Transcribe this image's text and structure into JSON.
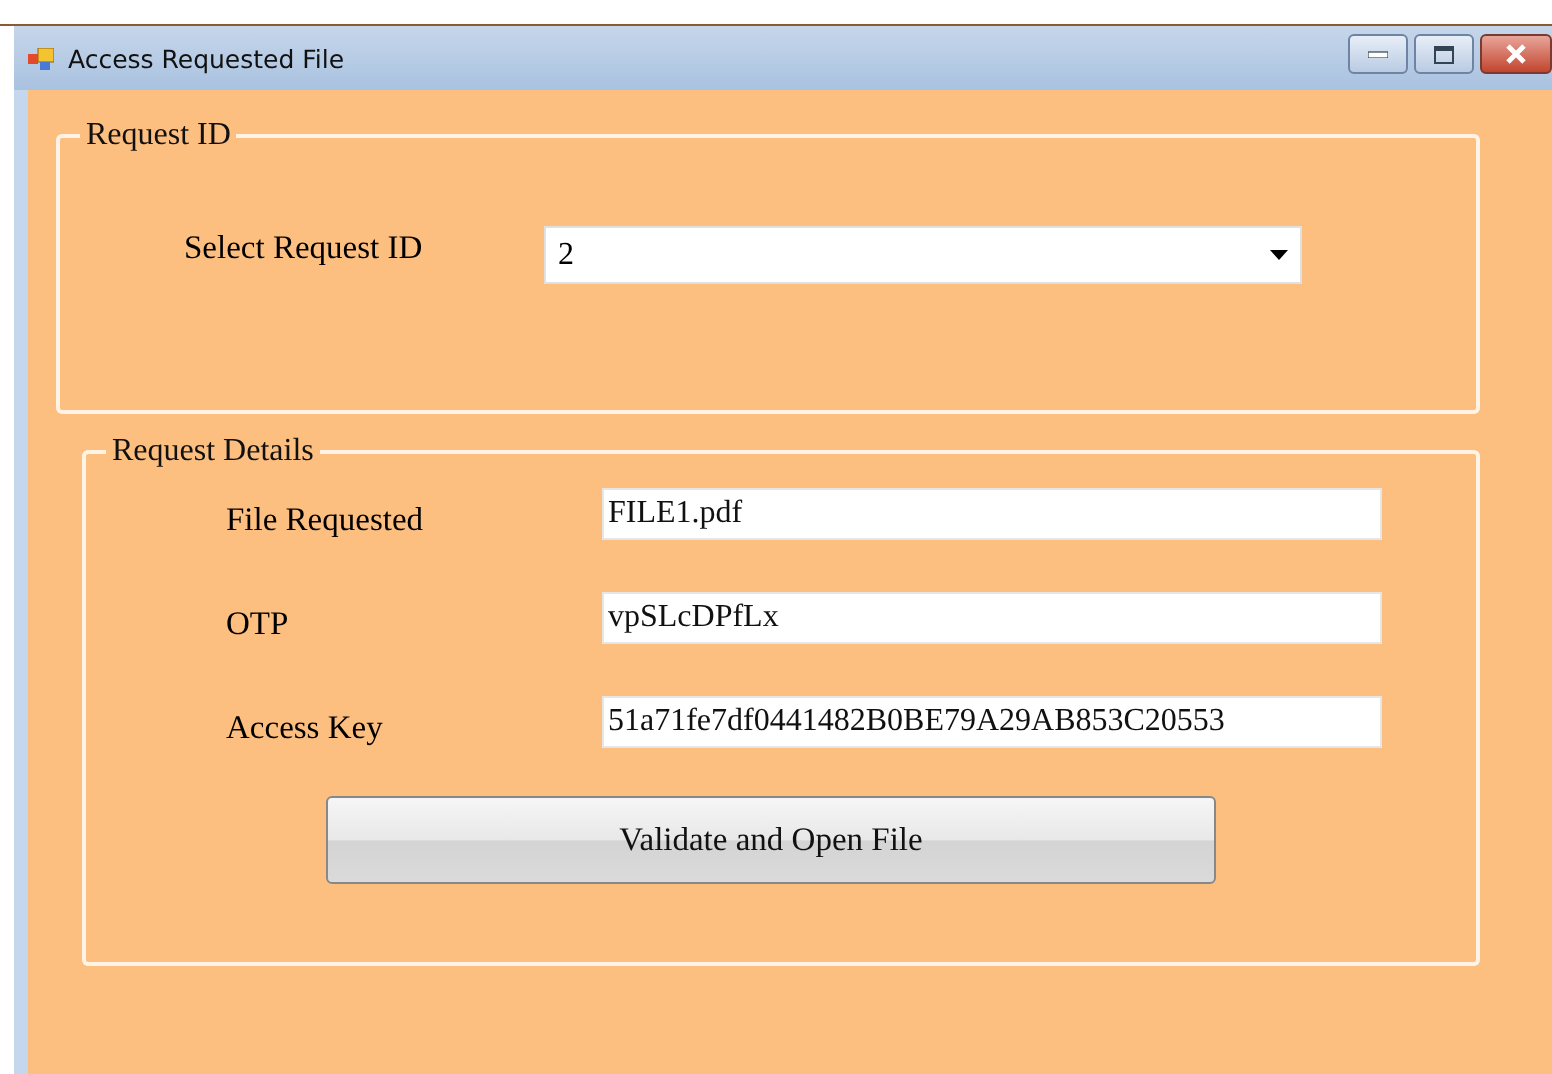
{
  "window": {
    "title": "Access Requested File"
  },
  "request_id_group": {
    "title": "Request ID",
    "label": "Select Request ID",
    "value": "2"
  },
  "details_group": {
    "title": "Request Details",
    "fields": [
      {
        "label": "File Requested",
        "value": "FILE1.pdf"
      },
      {
        "label": "OTP",
        "value": "vpSLcDPfLx"
      },
      {
        "label": "Access Key",
        "value": "51a71fe7df0441482B0BE79A29AB853C20553"
      }
    ]
  },
  "buttons": [
    "Validate and Open File"
  ]
}
